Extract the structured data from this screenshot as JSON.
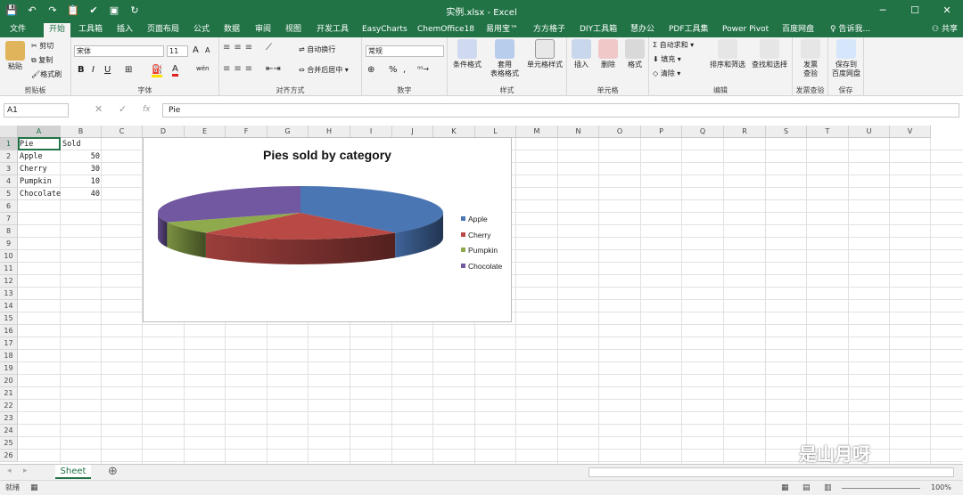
{
  "title": "实例.xlsx - Excel",
  "qat": [
    "save-icon",
    "undo-icon",
    "redo-icon",
    "paste-icon",
    "brush-icon",
    "camera-icon",
    "sync-icon"
  ],
  "window_controls": [
    "─",
    "☐",
    "✕"
  ],
  "tabs": [
    "文件",
    "开始",
    "工具箱",
    "插入",
    "页面布局",
    "公式",
    "数据",
    "审阅",
    "视图",
    "开发工具",
    "EasyCharts",
    "ChemOffice18",
    "易用宝™",
    "方方格子",
    "DIY工具箱",
    "慧办公",
    "PDF工具集",
    "Power Pivot",
    "百度网盘",
    "告诉我..."
  ],
  "share": "共享",
  "ribbon": {
    "clipboard": {
      "paste": "粘贴",
      "cut": "剪切",
      "copy": "复制",
      "painter": "格式刷",
      "label": "剪贴板"
    },
    "font": {
      "name": "宋体",
      "size": "11",
      "grow": "A",
      "shrink": "A",
      "bold": "B",
      "italic": "I",
      "underline": "U",
      "wen": "wén",
      "label": "字体"
    },
    "alignment": {
      "wrap": "自动换行",
      "merge": "合并后居中",
      "label": "对齐方式"
    },
    "number": {
      "format": "常规",
      "percent": "%",
      "comma": ",",
      "label": "数字"
    },
    "styles": {
      "conditional": "条件格式",
      "table": "套用",
      "table2": "表格格式",
      "cell": "单元格样式",
      "label": "样式"
    },
    "cells": {
      "insert": "插入",
      "delete": "删除",
      "format": "格式",
      "label": "单元格"
    },
    "editing": {
      "autosum": "自动求和",
      "fill": "填充",
      "clear": "清除",
      "sort": "排序和筛选",
      "find": "查找和选择",
      "label": "编辑"
    },
    "invoice": {
      "check": "发票",
      "check2": "查验",
      "label": "发票查验"
    },
    "save": {
      "save": "保存到",
      "save2": "百度网盘",
      "label": "保存"
    }
  },
  "namebox": "A1",
  "formula_icons": [
    "✕",
    "✓",
    "fx"
  ],
  "formula": "Pie",
  "columns": [
    "A",
    "B",
    "C",
    "D",
    "E",
    "F",
    "G",
    "H",
    "I",
    "J",
    "K",
    "L",
    "M",
    "N",
    "O",
    "P",
    "Q",
    "R",
    "S",
    "T",
    "U",
    "V"
  ],
  "rows": [
    "1",
    "2",
    "3",
    "4",
    "5",
    "6",
    "7",
    "8",
    "9",
    "10",
    "11",
    "12",
    "13",
    "14",
    "15",
    "16",
    "17",
    "18",
    "19",
    "20",
    "21",
    "22",
    "23",
    "24",
    "25",
    "26"
  ],
  "cells": {
    "headers": [
      "Pie",
      "Sold"
    ],
    "data": [
      [
        "Apple",
        "50"
      ],
      [
        "Cherry",
        "30"
      ],
      [
        "Pumpkin",
        "10"
      ],
      [
        "Chocolate",
        "40"
      ]
    ]
  },
  "chart_data": {
    "type": "pie",
    "title": "Pies sold by category",
    "categories": [
      "Apple",
      "Cherry",
      "Pumpkin",
      "Chocolate"
    ],
    "values": [
      50,
      30,
      10,
      40
    ],
    "colors": [
      "#4a76b4",
      "#b84945",
      "#8faa4c",
      "#7158a0"
    ],
    "legend_position": "right"
  },
  "sheet": "Sheet",
  "add_sheet": "⊕",
  "status": "就绪",
  "zoom": "100%",
  "watermark": "是山月呀"
}
